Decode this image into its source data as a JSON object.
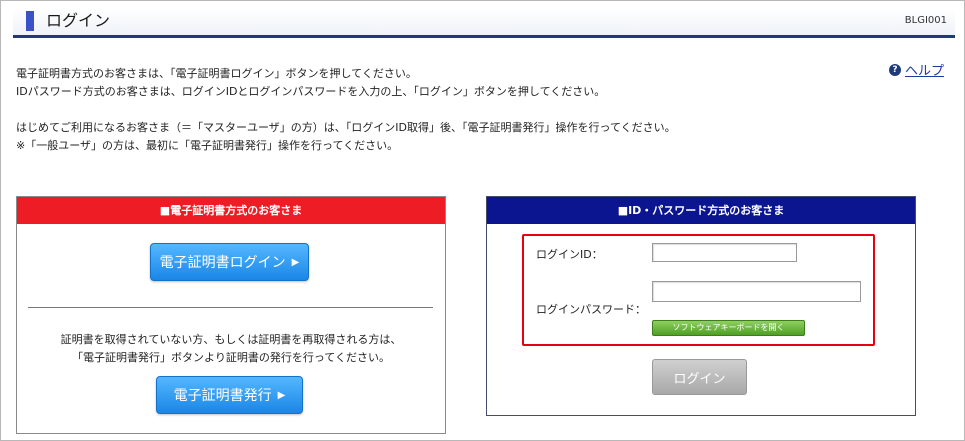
{
  "header": {
    "title": "ログイン",
    "screen_id": "BLGI001"
  },
  "help": {
    "label": "ヘルプ",
    "icon": "help-icon"
  },
  "intro": {
    "line1": "電子証明書方式のお客さまは、「電子証明書ログイン」ボタンを押してください。",
    "line2": "IDパスワード方式のお客さまは、ログインIDとログインパスワードを入力の上、「ログイン」ボタンを押してください。",
    "line3": "はじめてご利用になるお客さま（＝「マスターユーザ」の方）は、「ログインID取得」後、「電子証明書発行」操作を行ってください。",
    "line4": "※「一般ユーザ」の方は、最初に「電子証明書発行」操作を行ってください。"
  },
  "cert_panel": {
    "header": "■電子証明書方式のお客さま",
    "login_button": "電子証明書ログイン",
    "note_line1": "証明書を取得されていない方、もしくは証明書を再取得される方は、",
    "note_line2": "「電子証明書発行」ボタンより証明書の発行を行ってください。",
    "issue_button": "電子証明書発行"
  },
  "id_panel": {
    "header": "■ID・パスワード方式のお客さま",
    "login_id_label": "ログインID：",
    "login_id_value": "",
    "password_label": "ログインパスワード：",
    "password_value": "",
    "software_keyboard_button": "ソフトウェアキーボードを開く",
    "login_button": "ログイン"
  },
  "colors": {
    "cert_header": "#ee1c24",
    "id_header": "#0c1590",
    "title_rule": "#1f3a7a",
    "highlight_border": "#e60012"
  }
}
